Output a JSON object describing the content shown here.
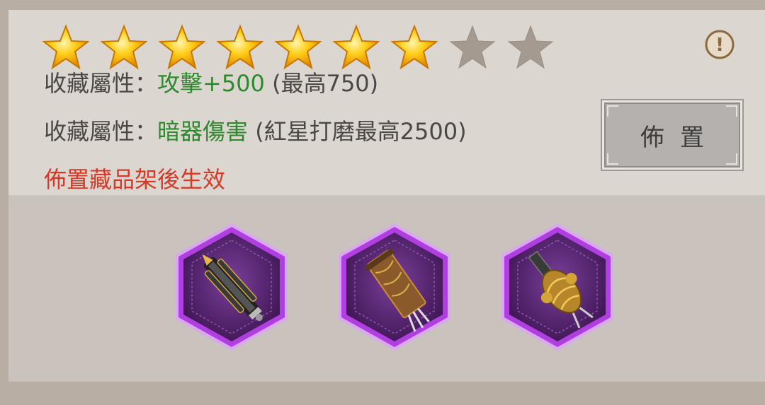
{
  "rating": {
    "filled": 7,
    "total": 9,
    "filled_color": "#f5b400",
    "empty_color": "#a49a90"
  },
  "info_icon": {
    "name": "info-icon",
    "glyph": "!"
  },
  "attributes": [
    {
      "label": "收藏屬性：",
      "value": "攻擊+500",
      "note": " (最高750)"
    },
    {
      "label": "收藏屬性：",
      "value": "暗器傷害",
      "note": " (紅星打磨最高2500)"
    }
  ],
  "notice": "佈置藏品架後生效",
  "place_button": {
    "label": "佈置"
  },
  "items": [
    {
      "name": "hidden-weapon-black-gold-icon",
      "color": "#8a2fb8"
    },
    {
      "name": "hidden-weapon-wooden-sheath-icon",
      "color": "#8a2fb8"
    },
    {
      "name": "hidden-weapon-golden-dragon-icon",
      "color": "#8a2fb8"
    }
  ],
  "colors": {
    "accent_green": "#2c8a2c",
    "notice_red": "#d43a26",
    "rarity_purple": "#b03ee0"
  }
}
